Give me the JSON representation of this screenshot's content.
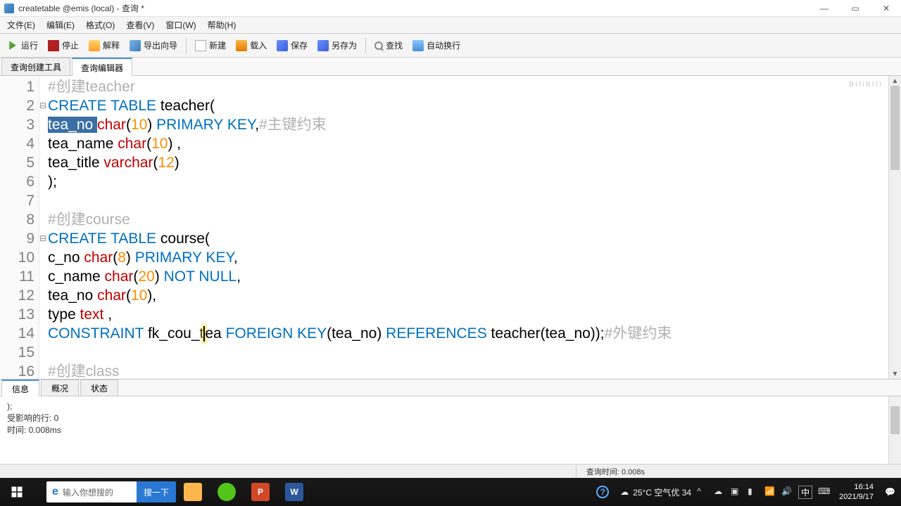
{
  "window": {
    "title": "createtable @emis (local) - 查询 *"
  },
  "menu": {
    "file": "文件(E)",
    "edit": "编辑(E)",
    "format": "格式(O)",
    "view": "查看(V)",
    "window": "窗口(W)",
    "help": "帮助(H)"
  },
  "toolbar": {
    "run": "运行",
    "stop": "停止",
    "explain": "解释",
    "wizard": "导出向导",
    "new": "新建",
    "load": "载入",
    "save": "保存",
    "saveas": "另存为",
    "find": "查找",
    "wrap": "自动换行"
  },
  "tabs": {
    "builder": "查询创建工具",
    "editor": "查询编辑器"
  },
  "code": {
    "lines": [
      {
        "n": "1",
        "fold": "",
        "html": "<span class='cmt'>#创建teacher</span>"
      },
      {
        "n": "2",
        "fold": "⊟",
        "html": "<span class='kw'>CREATE</span> <span class='kw'>TABLE</span> teacher("
      },
      {
        "n": "3",
        "fold": "",
        "html": "<span class='sel'>tea_no </span><span class='ty'>char</span>(<span class='num'>10</span>) <span class='kw'>PRIMARY</span> <span class='kw'>KEY</span>,<span class='cmt'>#主键约束</span>"
      },
      {
        "n": "4",
        "fold": "",
        "html": "tea_name <span class='ty'>char</span>(<span class='num'>10</span>) ,"
      },
      {
        "n": "5",
        "fold": "",
        "html": "tea_title <span class='ty'>varchar</span>(<span class='num'>12</span>)"
      },
      {
        "n": "6",
        "fold": "",
        "html": ");"
      },
      {
        "n": "7",
        "fold": "",
        "html": ""
      },
      {
        "n": "8",
        "fold": "",
        "html": "<span class='cmt'>#创建course</span>"
      },
      {
        "n": "9",
        "fold": "⊟",
        "html": "<span class='kw'>CREATE</span> <span class='kw'>TABLE</span> course("
      },
      {
        "n": "10",
        "fold": "",
        "html": "c_no <span class='ty'>char</span>(<span class='num'>8</span>) <span class='kw'>PRIMARY</span> <span class='kw'>KEY</span>,"
      },
      {
        "n": "11",
        "fold": "",
        "html": "c_name <span class='ty'>char</span>(<span class='num'>20</span>) <span class='kw'>NOT</span> <span class='kw'>NULL</span>,"
      },
      {
        "n": "12",
        "fold": "",
        "html": "tea_no <span class='ty'>char</span>(<span class='num'>10</span>),"
      },
      {
        "n": "13",
        "fold": "",
        "html": "type <span class='ty'>text</span> ,"
      },
      {
        "n": "14",
        "fold": "",
        "html": "<span class='kw'>CONSTRAINT</span> fk_cou_t<span class='cursor-yellow'></span>ea <span class='kw'>FOREIGN</span> <span class='kw'>KEY</span>(tea_no) <span class='kw'>REFERENCES</span> teacher(tea_no));<span class='cmt'>#外键约束</span>"
      },
      {
        "n": "15",
        "fold": "",
        "html": ""
      },
      {
        "n": "16",
        "fold": "",
        "html": "<span class='cmt'>#创建class</span>"
      }
    ]
  },
  "result_tabs": {
    "info": "信息",
    "profile": "概况",
    "status": "状态"
  },
  "result": {
    "l1": ");",
    "l2": "受影响的行: 0",
    "l3": "时间: 0.008ms"
  },
  "statusbar": {
    "time": "查询时间: 0.008s"
  },
  "taskbar": {
    "search_placeholder": "输入你想搜的",
    "search_btn": "搜一下",
    "weather": "25°C  空气优 34",
    "ime": "中",
    "clock_time": "16:14",
    "clock_date": "2021/9/17"
  },
  "watermark": "bilibili"
}
